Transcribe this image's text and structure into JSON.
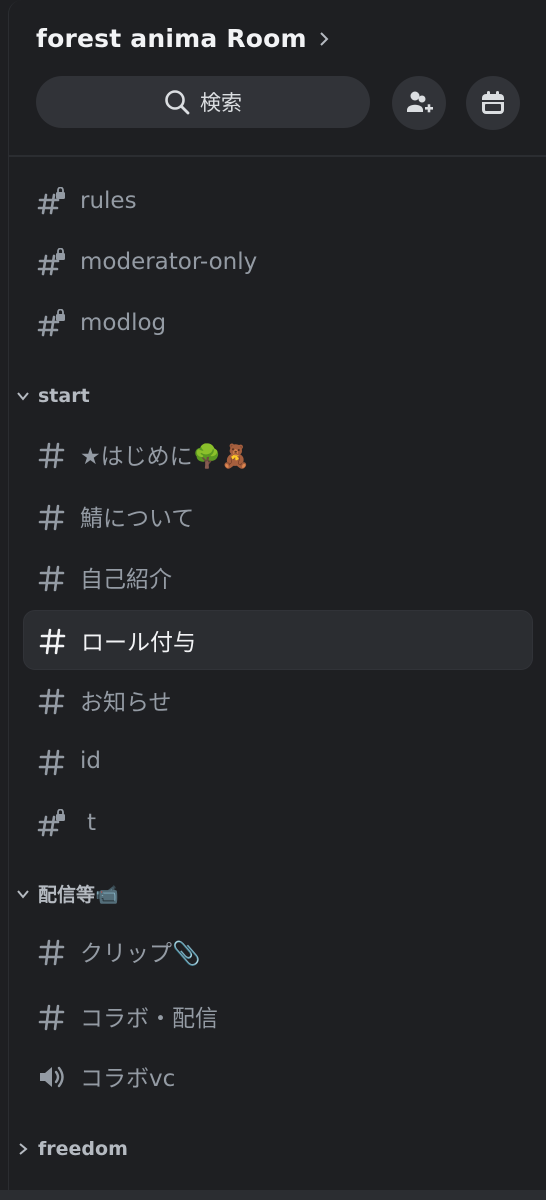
{
  "server": {
    "name": "forest anima Room"
  },
  "search": {
    "label": "検索"
  },
  "buttons": {
    "invite_icon": "add-member-icon",
    "events_icon": "calendar-icon"
  },
  "channels": [
    {
      "label": "rules",
      "type": "text-locked"
    },
    {
      "label": "moderator-only",
      "type": "text-locked"
    },
    {
      "label": "modlog",
      "type": "text-locked"
    }
  ],
  "categories": [
    {
      "name": "start",
      "expanded": true,
      "channels": [
        {
          "label": "★はじめに🌳🧸",
          "type": "text"
        },
        {
          "label": "鯖について",
          "type": "text"
        },
        {
          "label": "自己紹介",
          "type": "text"
        },
        {
          "label": "ロール付与",
          "type": "text",
          "active": true
        },
        {
          "label": "お知らせ",
          "type": "text"
        },
        {
          "label": "id",
          "type": "text"
        },
        {
          "label": "t",
          "type": "text-locked"
        }
      ]
    },
    {
      "name": "配信等📹",
      "expanded": true,
      "channels": [
        {
          "label": "クリップ📎",
          "type": "text"
        },
        {
          "label": "コラボ・配信",
          "type": "text"
        },
        {
          "label": "コラボvc",
          "type": "voice"
        }
      ]
    },
    {
      "name": "freedom",
      "expanded": false,
      "channels": []
    }
  ],
  "colors": {
    "bg": "#1e1f22",
    "active": "#2b2d31",
    "text": "#949ba4",
    "title": "#f2f3f5"
  }
}
